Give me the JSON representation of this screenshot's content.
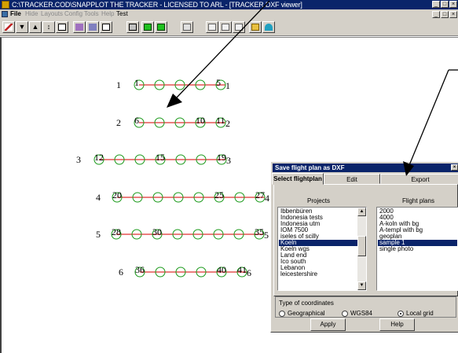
{
  "window": {
    "title": "C:\\TRACKER.COD\\SNAPPLOT THE TRACKER - LICENSED TO ARL - [TRACKER DXF viewer]",
    "title_buttons": [
      "_",
      "□",
      "×"
    ],
    "menu_buttons": [
      "_",
      "□",
      "×"
    ]
  },
  "menu": {
    "items": [
      {
        "label": "File",
        "enabled": true
      },
      {
        "label": "Hide",
        "enabled": false
      },
      {
        "label": "Layouts",
        "enabled": false
      },
      {
        "label": "Config",
        "enabled": false
      },
      {
        "label": "Tools",
        "enabled": false
      },
      {
        "label": "Help",
        "enabled": false
      },
      {
        "label": "Test",
        "enabled": true
      }
    ]
  },
  "flight_lines": [
    {
      "label": "1",
      "points": [
        {
          "n": "1"
        },
        {},
        {},
        {},
        {
          "n": "5"
        }
      ],
      "end_label": "1"
    },
    {
      "label": "2",
      "points": [
        {
          "n": "6"
        },
        {},
        {},
        {
          "n": "10"
        },
        {
          "n": "11"
        }
      ],
      "end_label": "2"
    },
    {
      "label": "3",
      "points": [
        {
          "n": "12"
        },
        {},
        {},
        {
          "n": "15"
        },
        {},
        {},
        {
          "n": "19"
        }
      ],
      "end_label": "3"
    },
    {
      "label": "4",
      "points": [
        {
          "n": "20"
        },
        {},
        {},
        {},
        {},
        {
          "n": "25"
        },
        {},
        {
          "n": "27"
        }
      ],
      "end_label": "4"
    },
    {
      "label": "5",
      "points": [
        {
          "n": "28"
        },
        {},
        {
          "n": "30"
        },
        {},
        {},
        {},
        {},
        {
          "n": "35"
        }
      ],
      "end_label": "5"
    },
    {
      "label": "6",
      "points": [
        {
          "n": "36"
        },
        {},
        {},
        {},
        {
          "n": "40"
        },
        {
          "n": "41"
        }
      ],
      "end_label": "6"
    }
  ],
  "colors": {
    "line": "#e03030",
    "point": "#1a9a1a",
    "selection": "#0a246a",
    "title_bar": "#0a246a",
    "chrome": "#d4d0c8"
  },
  "dialog": {
    "title": "Save flight plan as DXF",
    "close": "×",
    "tabs": [
      "Select flightplan",
      "Edit",
      "Export"
    ],
    "active_tab": "Select flightplan",
    "projects_label": "Projects",
    "flightplans_label": "Flight plans",
    "projects": [
      "Ibbenbüren",
      "Indonesia tests",
      "Indonesia utm",
      "IOM 7500",
      "iseles of scilly",
      "Koeln",
      "Koeln wgs",
      "Land end",
      "Ico south",
      "Lebanon",
      "leicestershire"
    ],
    "selected_project": "Koeln",
    "flight_plans": [
      "2000",
      "4000",
      "A-koln with bg",
      "A-templ with bg",
      "geoplan",
      "sample 1",
      "single photo"
    ],
    "selected_flight_plan": "sample 1",
    "coords_label": "Type of coordinates",
    "coord_options": [
      "Geographical",
      "WGS84",
      "Local grid"
    ],
    "selected_coord": "Local grid",
    "apply_label": "Apply",
    "help_label": "Help"
  }
}
